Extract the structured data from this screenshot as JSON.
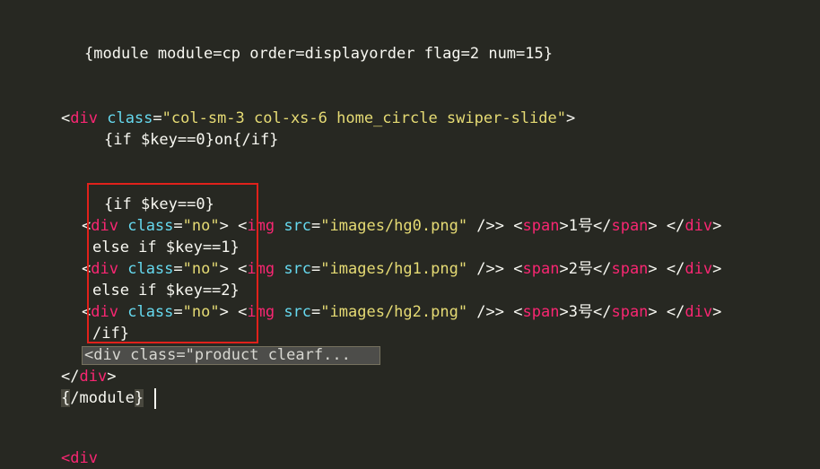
{
  "editor": {
    "line1": "{module module=cp order=displayorder flag=2 num=15}",
    "line2": {
      "open": "<",
      "tag": "div",
      "attr": "class",
      "eq": "=",
      "value": "\"col-sm-3 col-xs-6 home_circle swiper-slide\"",
      "close": ">"
    },
    "line3": "{if $key==0}on{/if}",
    "line4": "{if $key==0}",
    "rows": [
      {
        "num": "1号",
        "src": "\"images/hg0.png\""
      },
      {
        "num": "2号",
        "src": "\"images/hg1.png\""
      },
      {
        "num": "3号",
        "src": "\"images/hg2.png\""
      }
    ],
    "elseif1": "else if $key==1}",
    "elseif2": "else if $key==2}",
    "endif": "/if}",
    "fold_text": "<div class=\"product clearf...",
    "close_div": "div",
    "end_module_open": "{",
    "end_module_rest": "/module",
    "end_module_close": "}",
    "partial_bottom": "<div",
    "tokens": {
      "lt": "<",
      "gt": ">",
      "lt_slash": "</",
      "div": "div",
      "class": "class",
      "eq": "=",
      "no": "\"no\"",
      "img": "img",
      "src": "src",
      "self_close": " />",
      "span": "span"
    }
  },
  "colors": {
    "background": "#272822",
    "tag": "#f92672",
    "attribute": "#66d9ef",
    "string": "#e6db74",
    "text": "#f8f8f2",
    "highlight_box": "#e0211b"
  }
}
